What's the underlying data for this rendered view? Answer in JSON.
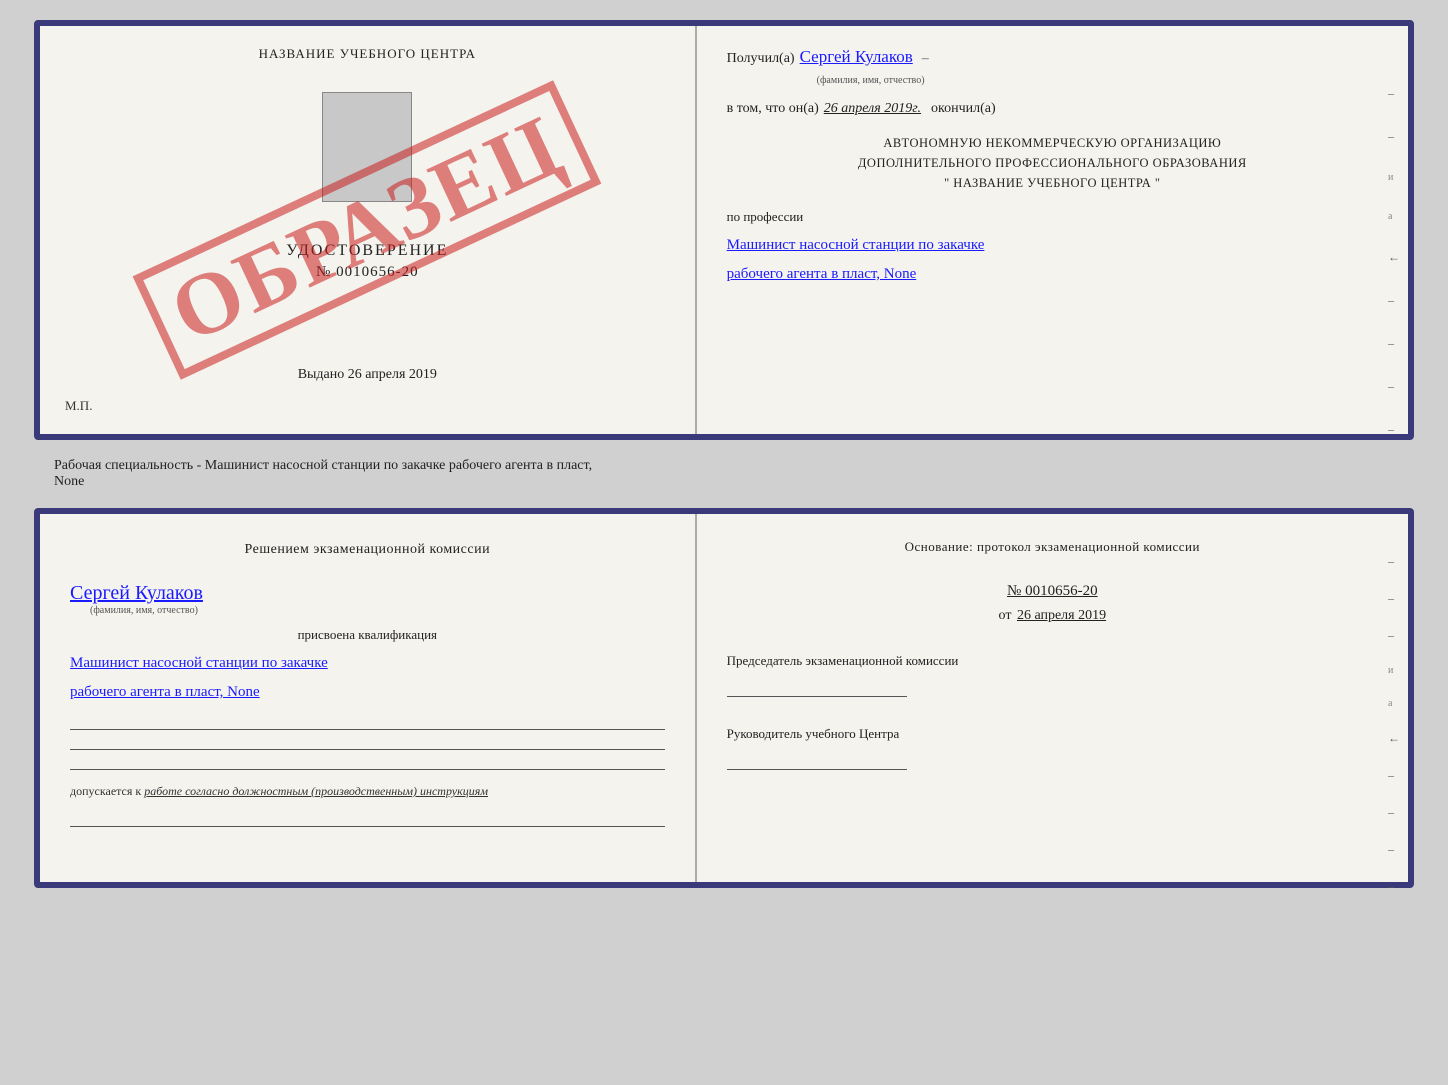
{
  "background_color": "#d0d0d0",
  "doc_top": {
    "left": {
      "school_name": "НАЗВАНИЕ УЧЕБНОГО ЦЕНТРА",
      "stamp": "ОБРАЗЕЦ",
      "certificate_label": "УДОСТОВЕРЕНИЕ",
      "certificate_number": "№ 0010656-20",
      "issued_text": "Выдано",
      "issued_date": "26 апреля 2019",
      "mp_label": "М.П."
    },
    "right": {
      "recipient_prefix": "Получил(а)",
      "recipient_name": "Сергей Кулаков",
      "recipient_sublabel": "(фамилия, имя, отчество)",
      "date_prefix": "в том, что он(а)",
      "date_value": "26 апреля 2019г.",
      "date_suffix": "окончил(а)",
      "org_line1": "АВТОНОМНУЮ НЕКОММЕРЧЕСКУЮ ОРГАНИЗАЦИЮ",
      "org_line2": "ДОПОЛНИТЕЛЬНОГО ПРОФЕССИОНАЛЬНОГО ОБРАЗОВАНИЯ",
      "org_line3": "\" НАЗВАНИЕ УЧЕБНОГО ЦЕНТРА \"",
      "profession_prefix": "по профессии",
      "profession_line1": "Машинист насосной станции по закачке",
      "profession_line2": "рабочего агента в пласт, None"
    }
  },
  "middle_text": "Рабочая специальность - Машинист насосной станции по закачке рабочего агента в пласт,\nNone",
  "doc_bottom": {
    "left": {
      "commission_text": "Решением экзаменационной комиссии",
      "person_name": "Сергей Кулаков",
      "name_sublabel": "(фамилия, имя, отчество)",
      "qualification_prefix": "присвоена квалификация",
      "qualification_line1": "Машинист насосной станции по закачке",
      "qualification_line2": "рабочего агента в пласт, None",
      "допускается_prefix": "допускается к",
      "допускается_text": "работе согласно должностным (производственным) инструкциям"
    },
    "right": {
      "osnov_text": "Основание: протокол экзаменационной комиссии",
      "protocol_number": "№ 0010656-20",
      "protocol_date_prefix": "от",
      "protocol_date": "26 апреля 2019",
      "chairman_label": "Председатель экзаменационной комиссии",
      "head_label": "Руководитель учебного Центра"
    }
  }
}
